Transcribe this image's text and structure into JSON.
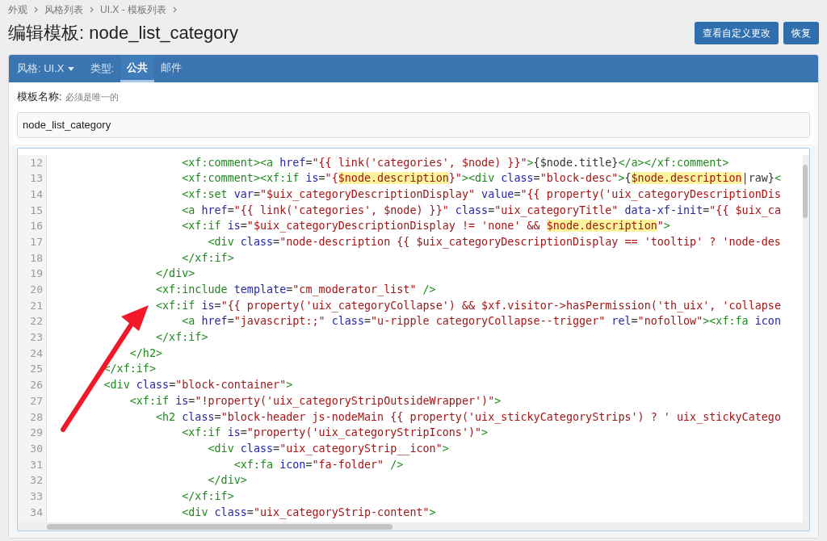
{
  "breadcrumbs": [
    "外观",
    "风格列表",
    "UI.X - 模板列表"
  ],
  "title": "编辑模板: node_list_category",
  "header_buttons": [
    "查看自定义更改",
    "恢复"
  ],
  "toolbar": {
    "style_menu": "风格: UI.X",
    "type_label": "类型:",
    "type_tabs": [
      {
        "label": "公共",
        "selected": true
      },
      {
        "label": "邮件",
        "selected": false
      }
    ]
  },
  "template_name": {
    "label": "模板名称:",
    "hint": "必须是唯一的",
    "value": "node_list_category"
  },
  "code_lines": [
    {
      "number": "12",
      "tokens": [
        {
          "kind": "tag",
          "text": "                    <xf:comment><a"
        },
        {
          "kind": "attr",
          "text": " href"
        },
        {
          "kind": "plain",
          "text": "="
        },
        {
          "kind": "str",
          "text": "\"{{ link('categories', $node) }}\""
        },
        {
          "kind": "tag",
          "text": ">"
        },
        {
          "kind": "plain",
          "text": "{$node.title}"
        },
        {
          "kind": "tag",
          "text": "</a></xf:comment>"
        }
      ]
    },
    {
      "number": "13",
      "tokens": [
        {
          "kind": "tag",
          "text": "                    <xf:comment><xf:if"
        },
        {
          "kind": "attr",
          "text": " is"
        },
        {
          "kind": "plain",
          "text": "="
        },
        {
          "kind": "str",
          "text": "\"{"
        },
        {
          "kind": "hl",
          "text": "$node.description"
        },
        {
          "kind": "str",
          "text": "}\""
        },
        {
          "kind": "tag",
          "text": "><div"
        },
        {
          "kind": "attr",
          "text": " class"
        },
        {
          "kind": "plain",
          "text": "="
        },
        {
          "kind": "str",
          "text": "\"block-desc\""
        },
        {
          "kind": "tag",
          "text": ">"
        },
        {
          "kind": "plain",
          "text": "{"
        },
        {
          "kind": "hl",
          "text": "$node.description"
        },
        {
          "kind": "plain",
          "text": "|raw}"
        },
        {
          "kind": "tag",
          "text": "<"
        }
      ]
    },
    {
      "number": "14",
      "tokens": [
        {
          "kind": "tag",
          "text": "                    <xf:set"
        },
        {
          "kind": "attr",
          "text": " var"
        },
        {
          "kind": "plain",
          "text": "="
        },
        {
          "kind": "str",
          "text": "\"$uix_categoryDescriptionDisplay\""
        },
        {
          "kind": "attr",
          "text": " value"
        },
        {
          "kind": "plain",
          "text": "="
        },
        {
          "kind": "str",
          "text": "\"{{ property('uix_categoryDescriptionDis"
        }
      ]
    },
    {
      "number": "15",
      "tokens": [
        {
          "kind": "tag",
          "text": "                    <a"
        },
        {
          "kind": "attr",
          "text": " href"
        },
        {
          "kind": "plain",
          "text": "="
        },
        {
          "kind": "str",
          "text": "\"{{ link('categories', $node) }}\""
        },
        {
          "kind": "attr",
          "text": " class"
        },
        {
          "kind": "plain",
          "text": "="
        },
        {
          "kind": "str",
          "text": "\"uix_categoryTitle\""
        },
        {
          "kind": "attr",
          "text": " data-xf-init"
        },
        {
          "kind": "plain",
          "text": "="
        },
        {
          "kind": "str",
          "text": "\"{{ $uix_ca"
        }
      ]
    },
    {
      "number": "16",
      "tokens": [
        {
          "kind": "tag",
          "text": "                    <xf:if"
        },
        {
          "kind": "attr",
          "text": " is"
        },
        {
          "kind": "plain",
          "text": "="
        },
        {
          "kind": "str",
          "text": "\"$uix_categoryDescriptionDisplay != 'none' && "
        },
        {
          "kind": "hl",
          "text": "$node.description"
        },
        {
          "kind": "str",
          "text": "\""
        },
        {
          "kind": "tag",
          "text": ">"
        }
      ]
    },
    {
      "number": "17",
      "tokens": [
        {
          "kind": "tag",
          "text": "                        <div"
        },
        {
          "kind": "attr",
          "text": " class"
        },
        {
          "kind": "plain",
          "text": "="
        },
        {
          "kind": "str",
          "text": "\"node-description {{ $uix_categoryDescriptionDisplay == 'tooltip' ? 'node-des"
        }
      ]
    },
    {
      "number": "18",
      "tokens": [
        {
          "kind": "tag",
          "text": "                    </xf:if>"
        }
      ]
    },
    {
      "number": "19",
      "tokens": [
        {
          "kind": "tag",
          "text": "                </div>"
        }
      ]
    },
    {
      "number": "20",
      "tokens": [
        {
          "kind": "tag",
          "text": "                <xf:include"
        },
        {
          "kind": "attr",
          "text": " template"
        },
        {
          "kind": "plain",
          "text": "="
        },
        {
          "kind": "str",
          "text": "\"cm_moderator_list\""
        },
        {
          "kind": "tag",
          "text": " />"
        }
      ]
    },
    {
      "number": "21",
      "tokens": [
        {
          "kind": "tag",
          "text": "                <xf:if"
        },
        {
          "kind": "attr",
          "text": " is"
        },
        {
          "kind": "plain",
          "text": "="
        },
        {
          "kind": "str",
          "text": "\"{{ property('uix_categoryCollapse') && $xf.visitor->hasPermission('th_uix', 'collapse"
        }
      ]
    },
    {
      "number": "22",
      "tokens": [
        {
          "kind": "tag",
          "text": "                    <a"
        },
        {
          "kind": "attr",
          "text": " href"
        },
        {
          "kind": "plain",
          "text": "="
        },
        {
          "kind": "str",
          "text": "\"javascript:;\""
        },
        {
          "kind": "attr",
          "text": " class"
        },
        {
          "kind": "plain",
          "text": "="
        },
        {
          "kind": "str",
          "text": "\"u-ripple categoryCollapse--trigger\""
        },
        {
          "kind": "attr",
          "text": " rel"
        },
        {
          "kind": "plain",
          "text": "="
        },
        {
          "kind": "str",
          "text": "\"nofollow\""
        },
        {
          "kind": "tag",
          "text": "><xf:fa"
        },
        {
          "kind": "attr",
          "text": " icon"
        }
      ]
    },
    {
      "number": "23",
      "tokens": [
        {
          "kind": "tag",
          "text": "                </xf:if>"
        }
      ]
    },
    {
      "number": "24",
      "tokens": [
        {
          "kind": "tag",
          "text": "            </h2>"
        }
      ]
    },
    {
      "number": "25",
      "tokens": [
        {
          "kind": "tag",
          "text": "        </xf:if>"
        }
      ]
    },
    {
      "number": "26",
      "tokens": [
        {
          "kind": "tag",
          "text": "        <div"
        },
        {
          "kind": "attr",
          "text": " class"
        },
        {
          "kind": "plain",
          "text": "="
        },
        {
          "kind": "str",
          "text": "\"block-container\""
        },
        {
          "kind": "tag",
          "text": ">"
        }
      ]
    },
    {
      "number": "27",
      "tokens": [
        {
          "kind": "tag",
          "text": "            <xf:if"
        },
        {
          "kind": "attr",
          "text": " is"
        },
        {
          "kind": "plain",
          "text": "="
        },
        {
          "kind": "str",
          "text": "\"!property('uix_categoryStripOutsideWrapper')\""
        },
        {
          "kind": "tag",
          "text": ">"
        }
      ]
    },
    {
      "number": "28",
      "tokens": [
        {
          "kind": "tag",
          "text": "                <h2"
        },
        {
          "kind": "attr",
          "text": " class"
        },
        {
          "kind": "plain",
          "text": "="
        },
        {
          "kind": "str",
          "text": "\"block-header js-nodeMain {{ property('uix_stickyCategoryStrips') ? ' uix_stickyCatego"
        }
      ]
    },
    {
      "number": "29",
      "tokens": [
        {
          "kind": "tag",
          "text": "                    <xf:if"
        },
        {
          "kind": "attr",
          "text": " is"
        },
        {
          "kind": "plain",
          "text": "="
        },
        {
          "kind": "str",
          "text": "\"property('uix_categoryStripIcons')\""
        },
        {
          "kind": "tag",
          "text": ">"
        }
      ]
    },
    {
      "number": "30",
      "tokens": [
        {
          "kind": "tag",
          "text": "                        <div"
        },
        {
          "kind": "attr",
          "text": " class"
        },
        {
          "kind": "plain",
          "text": "="
        },
        {
          "kind": "str",
          "text": "\"uix_categoryStrip__icon\""
        },
        {
          "kind": "tag",
          "text": ">"
        }
      ]
    },
    {
      "number": "31",
      "tokens": [
        {
          "kind": "tag",
          "text": "                            <xf:fa"
        },
        {
          "kind": "attr",
          "text": " icon"
        },
        {
          "kind": "plain",
          "text": "="
        },
        {
          "kind": "str",
          "text": "\"fa-folder\""
        },
        {
          "kind": "tag",
          "text": " />"
        }
      ]
    },
    {
      "number": "32",
      "tokens": [
        {
          "kind": "tag",
          "text": "                        </div>"
        }
      ]
    },
    {
      "number": "33",
      "tokens": [
        {
          "kind": "tag",
          "text": "                    </xf:if>"
        }
      ]
    },
    {
      "number": "34",
      "tokens": [
        {
          "kind": "tag",
          "text": "                    <div"
        },
        {
          "kind": "attr",
          "text": " class"
        },
        {
          "kind": "plain",
          "text": "="
        },
        {
          "kind": "str",
          "text": "\"uix_categoryStrip-content\""
        },
        {
          "kind": "tag",
          "text": ">"
        }
      ]
    }
  ]
}
